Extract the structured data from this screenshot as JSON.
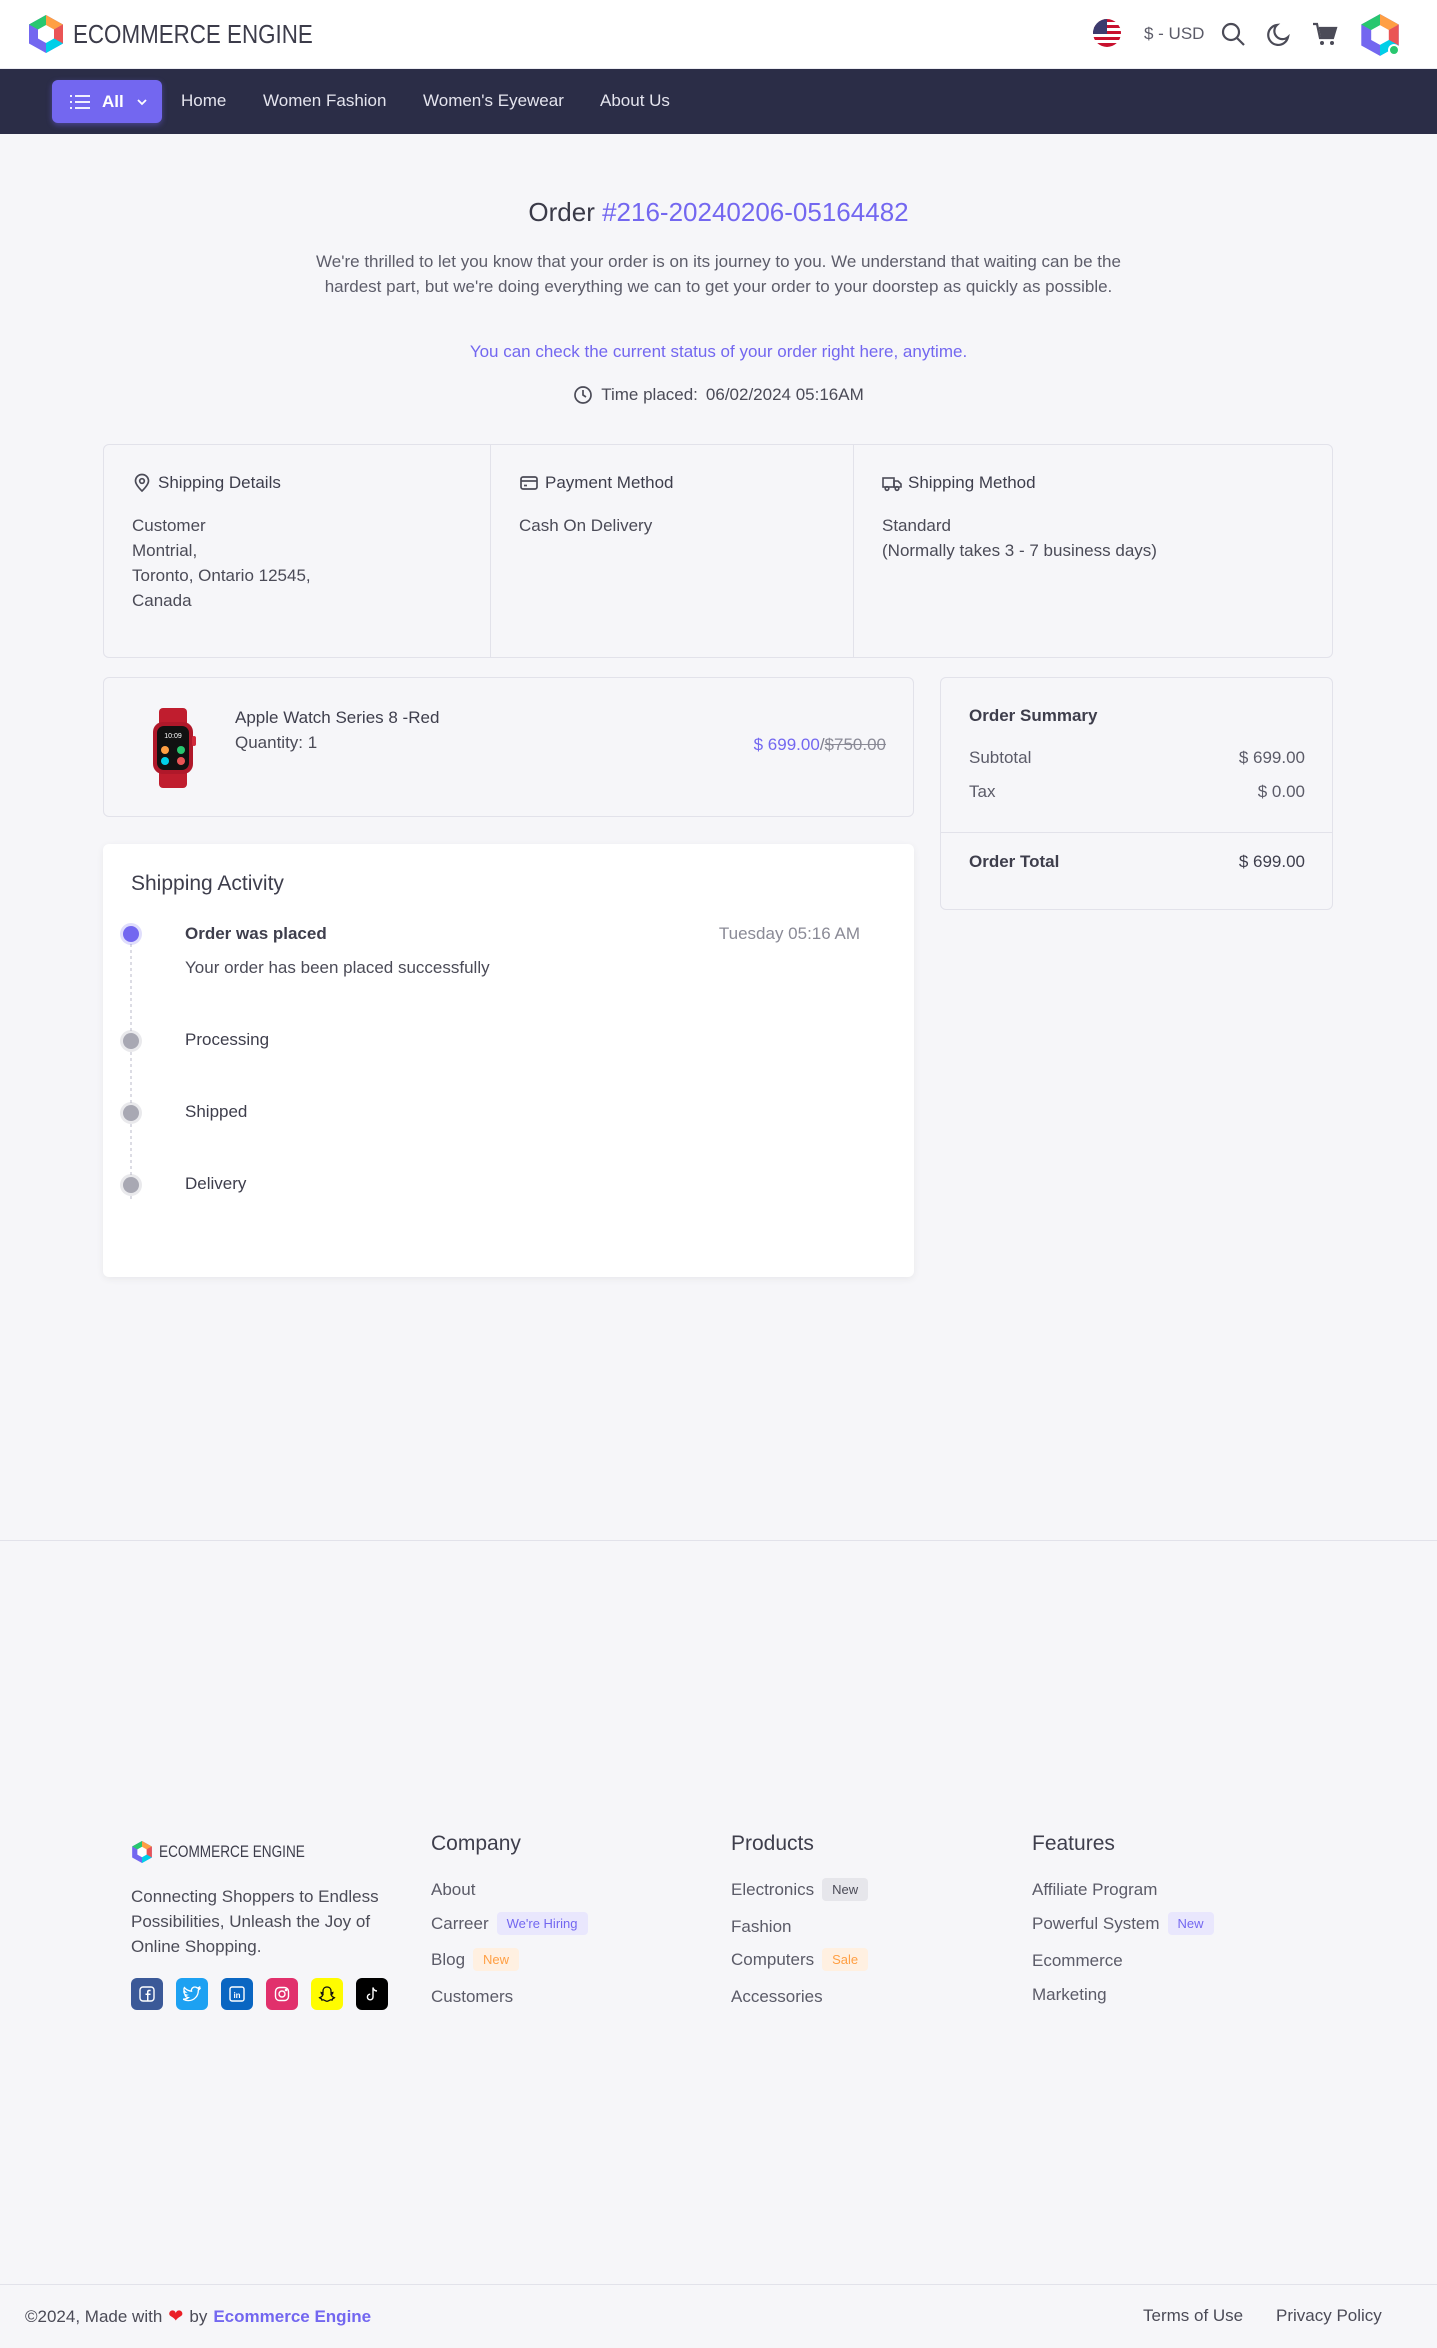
{
  "header": {
    "brand": "ECOMMERCE ENGINE",
    "currency": "$ - USD",
    "icons": [
      "us-flag-icon",
      "search-icon",
      "moon-icon",
      "cart-icon",
      "user-avatar"
    ]
  },
  "nav": {
    "all_label": "All",
    "links": [
      "Home",
      "Women Fashion",
      "Women's Eyewear",
      "About Us"
    ]
  },
  "order": {
    "title_prefix": "Order",
    "number": "#216-20240206-05164482",
    "message": "We're thrilled to let you know that your order is on its journey to you. We understand that waiting can be the hardest part, but we're doing everything we can to get your order to your doorstep as quickly as possible.",
    "status_link": "You can check the current status of your order right here, anytime.",
    "time_label": "Time placed:",
    "time_value": "06/02/2024 05:16AM"
  },
  "shipping_details": {
    "title": "Shipping Details",
    "lines": [
      "Customer",
      "Montrial,",
      "Toronto, Ontario 12545,",
      "Canada"
    ]
  },
  "payment_method": {
    "title": "Payment Method",
    "value": "Cash On Delivery"
  },
  "shipping_method": {
    "title": "Shipping Method",
    "lines": [
      "Standard",
      "(Normally takes 3 - 7 business days)"
    ]
  },
  "product": {
    "name": "Apple Watch Series 8 -Red",
    "quantity": "Quantity: 1",
    "price": "$ 699.00",
    "separator": "/",
    "original_price": "$750.00"
  },
  "summary": {
    "title": "Order Summary",
    "subtotal_label": "Subtotal",
    "subtotal_value": "$ 699.00",
    "tax_label": "Tax",
    "tax_value": "$ 0.00",
    "total_label": "Order Total",
    "total_value": "$ 699.00"
  },
  "activity": {
    "title": "Shipping Activity",
    "steps": [
      {
        "label": "Order was placed",
        "desc": "Your order has been placed successfully",
        "time": "Tuesday 05:16 AM",
        "status": "done"
      },
      {
        "label": "Processing",
        "status": "pending"
      },
      {
        "label": "Shipped",
        "status": "pending"
      },
      {
        "label": "Delivery",
        "status": "pending"
      }
    ]
  },
  "footer": {
    "brand": "ECOMMERCE ENGINE",
    "about": "Connecting Shoppers to Endless Possibilities, Unleash the Joy of Online Shopping.",
    "socials": [
      "facebook-icon",
      "twitter-icon",
      "linkedin-icon",
      "instagram-icon",
      "snapchat-icon",
      "tiktok-icon"
    ],
    "company": {
      "title": "Company",
      "links": [
        {
          "label": "About"
        },
        {
          "label": "Carreer",
          "badge": "We're Hiring"
        },
        {
          "label": "Blog",
          "badge": "New"
        },
        {
          "label": "Customers"
        }
      ]
    },
    "products": {
      "title": "Products",
      "links": [
        {
          "label": "Electronics",
          "badge": "New"
        },
        {
          "label": "Fashion"
        },
        {
          "label": "Computers",
          "badge": "Sale"
        },
        {
          "label": "Accessories"
        }
      ]
    },
    "features": {
      "title": "Features",
      "links": [
        {
          "label": "Affiliate Program"
        },
        {
          "label": "Powerful System",
          "badge": "New"
        },
        {
          "label": "Ecommerce"
        },
        {
          "label": "Marketing"
        }
      ]
    },
    "copyright_prefix": "©2024, Made with",
    "copyright_by": "by",
    "copyright_brand": "Ecommerce Engine",
    "bottom_links": [
      "Terms of Use",
      "Privacy Policy"
    ]
  },
  "colors": {
    "accent": "#7367f0",
    "nav_bg": "#2b2d47",
    "page_bg": "#f6f6f9",
    "success": "#28c76f",
    "warning": "#ff9f43"
  }
}
